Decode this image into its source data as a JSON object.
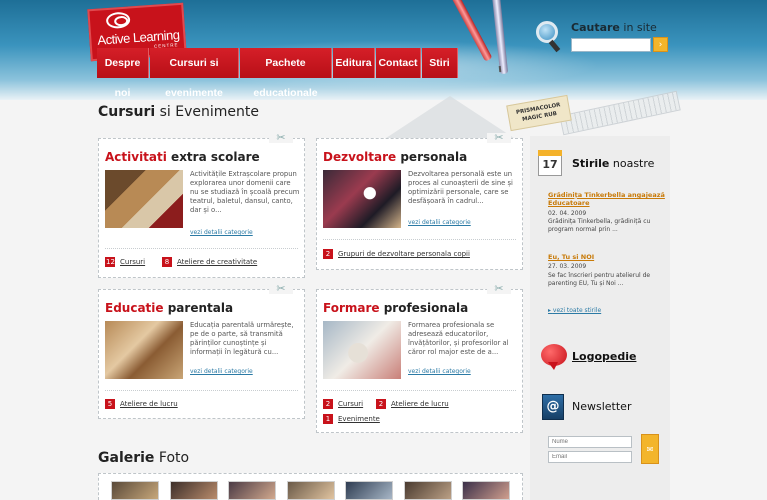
{
  "logo": {
    "text": "Active Learning",
    "sub": "CENTRE"
  },
  "nav": {
    "items": [
      {
        "label": "Despre noi"
      },
      {
        "label": "Cursuri si evenimente"
      },
      {
        "label": "Pachete educationale"
      },
      {
        "label": "Editura"
      },
      {
        "label": "Contact"
      },
      {
        "label": "Stiri"
      }
    ]
  },
  "search": {
    "title_bold": "Cautare",
    "title_rest": " in site",
    "value": "",
    "button": "›"
  },
  "eraser": {
    "line1": "PRISMACOLOR",
    "line2": "MAGIC RUB"
  },
  "main": {
    "title_bold": "Cursuri",
    "title_rest": " si Evenimente",
    "boxes": [
      {
        "title_red": "Activitati",
        "title_rest": " extra scolare",
        "desc": "Activitățile Extrașcolare propun explorarea unor domenii care nu se studiază în școală precum teatrul, baletul, dansul, canto, dar și o...",
        "more": "vezi detalii categorie",
        "tags": [
          {
            "num": "12",
            "label": "Cursuri"
          },
          {
            "num": "8",
            "label": "Ateliere de creativitate"
          }
        ]
      },
      {
        "title_red": "Dezvoltare",
        "title_rest": " personala",
        "desc": "Dezvoltarea personală este un proces al cunoașterii de sine și optimizării personale, care se desfășoară în cadrul...",
        "more": "vezi detalii categorie",
        "tags": [
          {
            "num": "2",
            "label": "Grupuri de dezvoltare personala copii"
          }
        ]
      },
      {
        "title_red": "Educatie",
        "title_rest": " parentala",
        "desc": "Educația parentală urmărește, pe de o parte, să transmită părinților cunoștințe și informații în legătură cu...",
        "more": "vezi detalii categorie",
        "tags": [
          {
            "num": "5",
            "label": "Ateliere de lucru"
          }
        ]
      },
      {
        "title_red": "Formare",
        "title_rest": " profesionala",
        "desc": "Formarea profesionala se adresează educatorilor, învățătorilor, și profesorilor al căror rol major este de a...",
        "more": "vezi detalii categorie",
        "tags": [
          {
            "num": "2",
            "label": "Cursuri"
          },
          {
            "num": "2",
            "label": "Ateliere de lucru"
          },
          {
            "num": "1",
            "label": "Evenimente"
          }
        ]
      }
    ]
  },
  "sidebar": {
    "calendar_day": "17",
    "news_title_bold": "Stirile",
    "news_title_rest": " noastre",
    "news": [
      {
        "title": "Grădinița Tinkerbella angajează Educatoare",
        "date": "02. 04. 2009",
        "text": "Grădinița Tinkerbella, grădiniță cu program normal prin ..."
      },
      {
        "title": "Eu, Tu si NOI",
        "date": "27. 03. 2009",
        "text": "Se fac înscrieri pentru atelierul de parenting EU, Tu și Noi ..."
      }
    ],
    "all_news": "vezi toate stirile",
    "logopedie": "Logopedie",
    "newsletter": "Newsletter",
    "newsletter_icon": "@",
    "name_placeholder": "Nume",
    "email_placeholder": "Email",
    "submit_icon": "envelope-icon"
  },
  "gallery": {
    "title_bold": "Galerie",
    "title_rest": " Foto"
  },
  "colors": {
    "brand_red": "#c8121b",
    "accent_orange": "#f3b52b",
    "link_blue": "#2b7aa5"
  }
}
